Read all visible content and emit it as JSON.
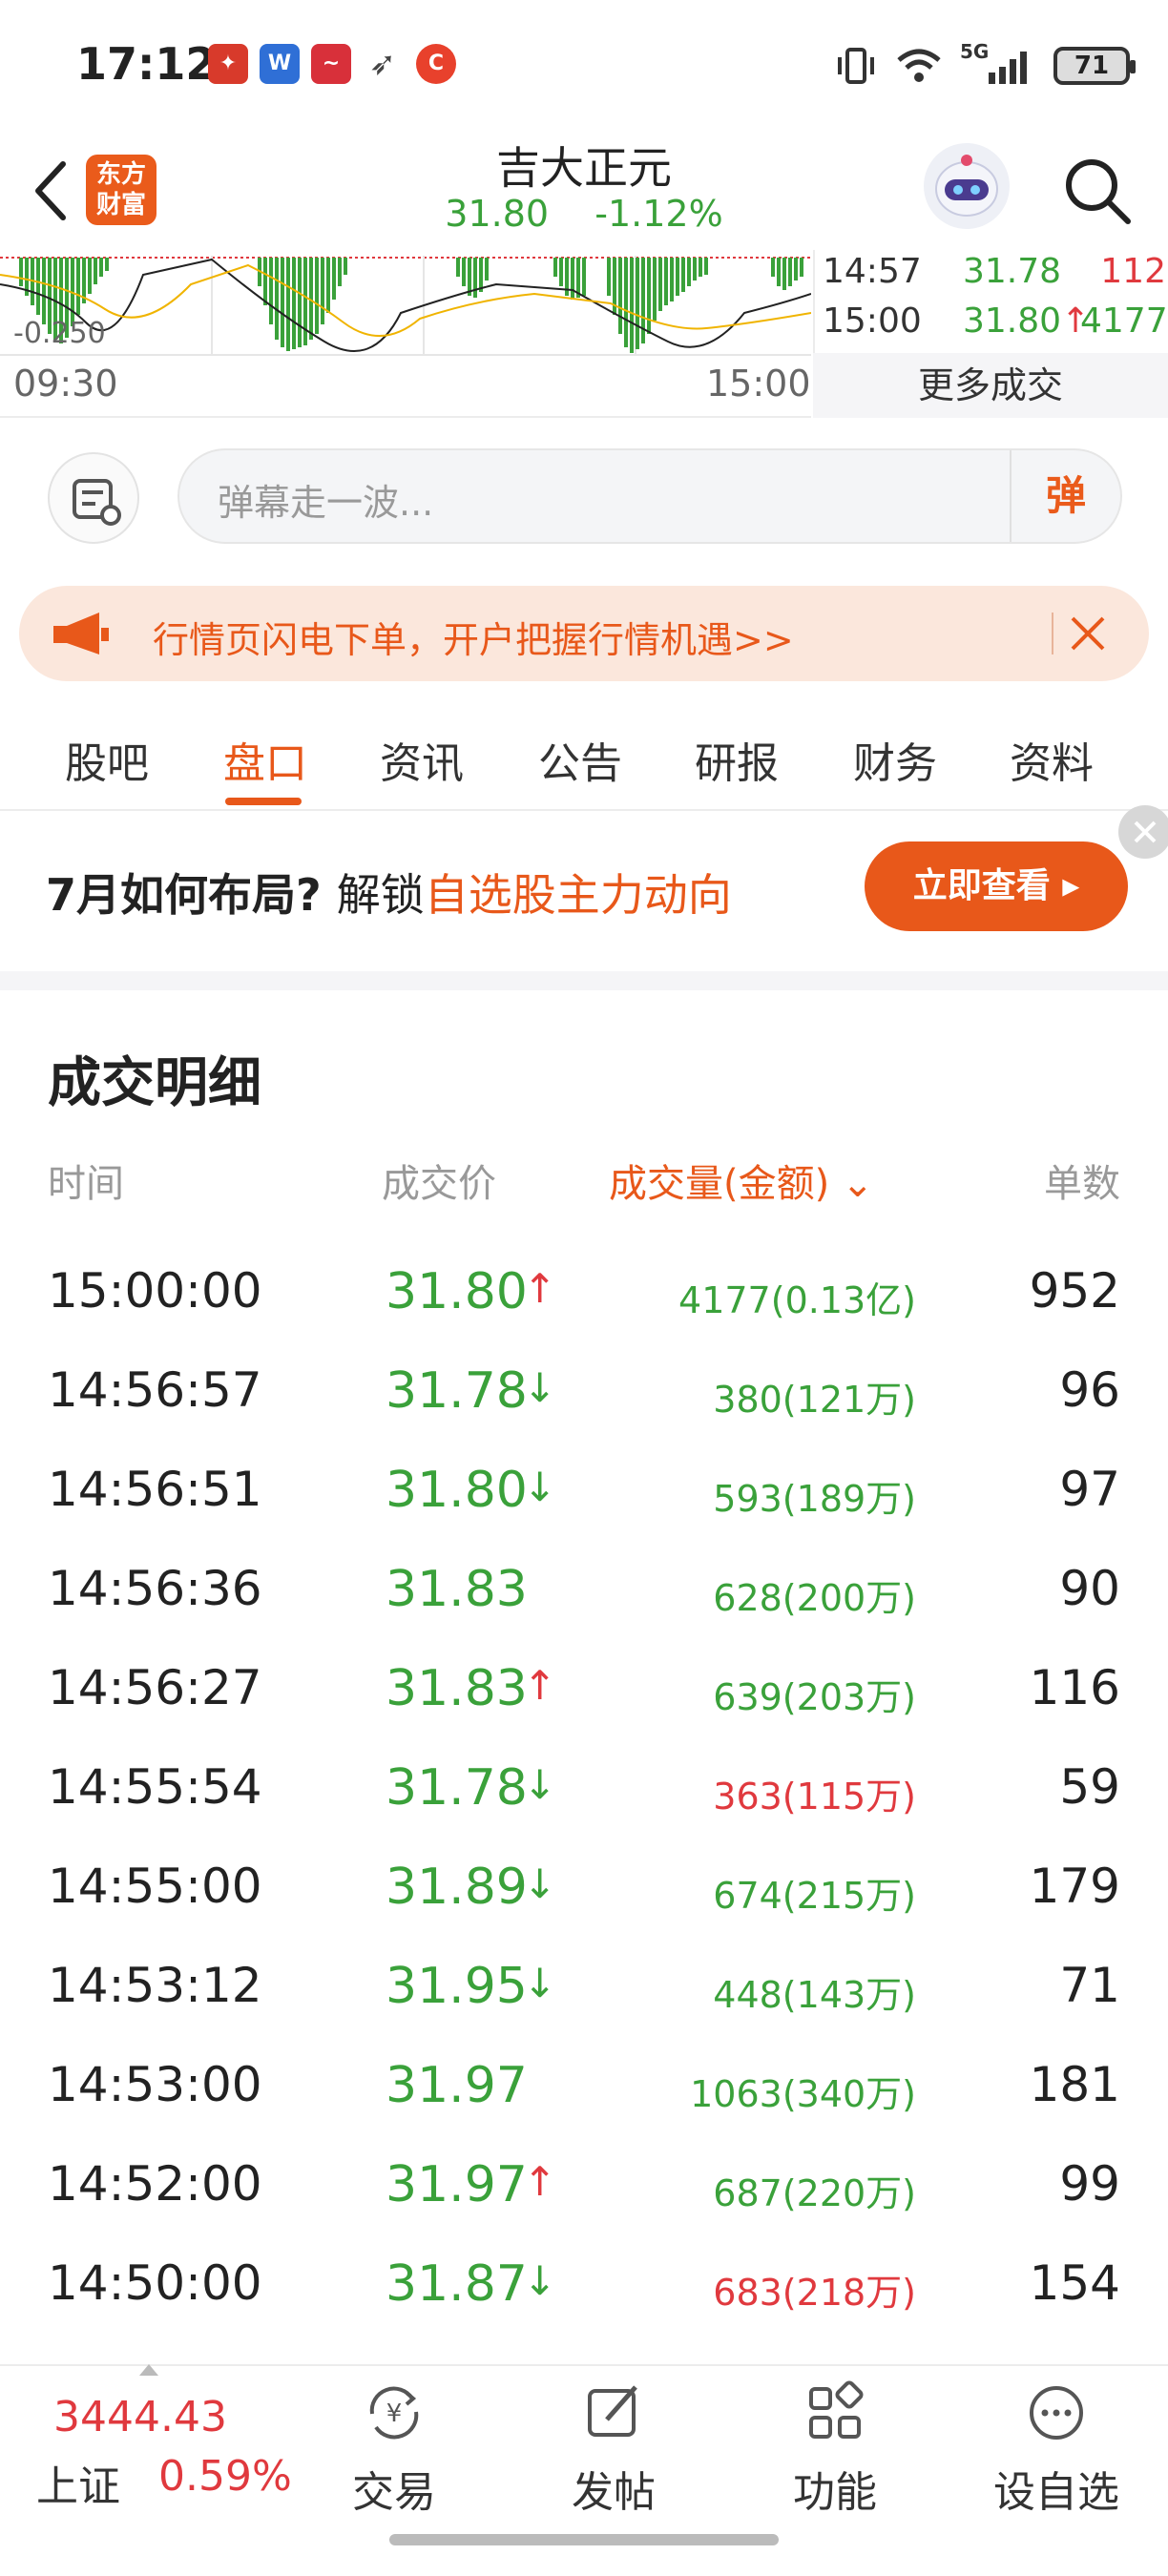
{
  "status_bar": {
    "time": "17:12",
    "battery": "71",
    "network": "5G"
  },
  "header": {
    "title": "吉大正元",
    "price": "31.80",
    "change_pct": "-1.12%",
    "logo_line1": "东方",
    "logo_line2": "财富"
  },
  "chart": {
    "y_label": "-0.250",
    "start_time": "09:30",
    "end_time": "15:00"
  },
  "ticker": [
    {
      "time": "14:57",
      "price": "31.78",
      "arrow": "",
      "vol": "112"
    },
    {
      "time": "15:00",
      "price": "31.80",
      "arrow": "↑",
      "vol": "4177"
    }
  ],
  "more_deals": "更多成交",
  "danmu": {
    "placeholder": "弹幕走一波...",
    "button": "弹"
  },
  "promo": {
    "text": "行情页闪电下单，开户把握行情机遇>>"
  },
  "tabs": [
    {
      "label": "股吧"
    },
    {
      "label": "盘口"
    },
    {
      "label": "资讯"
    },
    {
      "label": "公告"
    },
    {
      "label": "研报"
    },
    {
      "label": "财务"
    },
    {
      "label": "资料"
    }
  ],
  "ad": {
    "prefix": "7月如何布局?",
    "middle": "解锁",
    "highlight": "自选股主力动向",
    "button": "立即查看 ▸"
  },
  "detail": {
    "title": "成交明细",
    "headers": {
      "time": "时间",
      "price": "成交价",
      "volume": "成交量(金额)",
      "volume_sort": "⌄",
      "count": "单数"
    },
    "rows": [
      {
        "time": "15:00:00",
        "price": "31.80",
        "arrow": "↑",
        "dir": "up",
        "vol": "4177(0.13亿)",
        "vol_color": "green",
        "count": "952"
      },
      {
        "time": "14:56:57",
        "price": "31.78",
        "arrow": "↓",
        "dir": "down",
        "vol": "380(121万)",
        "vol_color": "green",
        "count": "96"
      },
      {
        "time": "14:56:51",
        "price": "31.80",
        "arrow": "↓",
        "dir": "down",
        "vol": "593(189万)",
        "vol_color": "green",
        "count": "97"
      },
      {
        "time": "14:56:36",
        "price": "31.83",
        "arrow": "",
        "dir": "",
        "vol": "628(200万)",
        "vol_color": "green",
        "count": "90"
      },
      {
        "time": "14:56:27",
        "price": "31.83",
        "arrow": "↑",
        "dir": "up",
        "vol": "639(203万)",
        "vol_color": "green",
        "count": "116"
      },
      {
        "time": "14:55:54",
        "price": "31.78",
        "arrow": "↓",
        "dir": "down",
        "vol": "363(115万)",
        "vol_color": "red",
        "count": "59"
      },
      {
        "time": "14:55:00",
        "price": "31.89",
        "arrow": "↓",
        "dir": "down",
        "vol": "674(215万)",
        "vol_color": "green",
        "count": "179"
      },
      {
        "time": "14:53:12",
        "price": "31.95",
        "arrow": "↓",
        "dir": "down",
        "vol": "448(143万)",
        "vol_color": "green",
        "count": "71"
      },
      {
        "time": "14:53:00",
        "price": "31.97",
        "arrow": "",
        "dir": "",
        "vol": "1063(340万)",
        "vol_color": "green",
        "count": "181"
      },
      {
        "time": "14:52:00",
        "price": "31.97",
        "arrow": "↑",
        "dir": "up",
        "vol": "687(220万)",
        "vol_color": "green",
        "count": "99"
      },
      {
        "time": "14:50:00",
        "price": "31.87",
        "arrow": "↓",
        "dir": "down",
        "vol": "683(218万)",
        "vol_color": "red",
        "count": "154"
      }
    ]
  },
  "bottom_bar": {
    "index_value": "3444.43",
    "index_name": "上证",
    "index_change": "0.59%",
    "nav": [
      {
        "label": "交易",
        "icon": "yuan-exchange-icon"
      },
      {
        "label": "发帖",
        "icon": "edit-post-icon"
      },
      {
        "label": "功能",
        "icon": "grid-function-icon"
      },
      {
        "label": "设自选",
        "icon": "more-dots-icon"
      }
    ]
  }
}
